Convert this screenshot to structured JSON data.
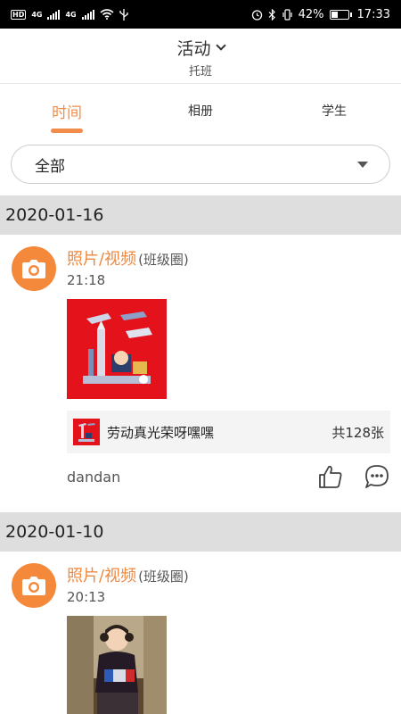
{
  "status_bar": {
    "hd_label": "HD",
    "net1": "4G",
    "net2": "4G",
    "battery": "42%",
    "battery_level": 0.42,
    "time": "17:33"
  },
  "header": {
    "title": "活动",
    "subtitle": "托班"
  },
  "tabs": [
    {
      "label": "时间",
      "active": true
    },
    {
      "label": "相册",
      "active": false
    },
    {
      "label": "学生",
      "active": false
    }
  ],
  "filter": {
    "value": "全部"
  },
  "groups": [
    {
      "date": "2020-01-16",
      "post": {
        "icon": "camera-icon",
        "type": "照片/视频",
        "scope": "(班级圈)",
        "time": "21:18",
        "album_name": "劳动真光荣呀嘿嘿",
        "album_count": "共128张",
        "author": "dandan"
      }
    },
    {
      "date": "2020-01-10",
      "post": {
        "icon": "camera-icon",
        "type": "照片/视频",
        "scope": "(班级圈)",
        "time": "20:13"
      }
    }
  ],
  "colors": {
    "accent": "#f28c4a",
    "icon_bg": "#f4883b",
    "date_bar": "#dedede"
  }
}
